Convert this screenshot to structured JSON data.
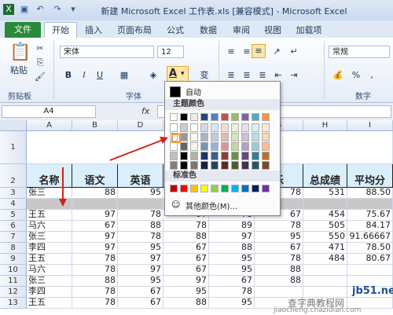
{
  "window": {
    "title": "新建 Microsoft Excel 工作表.xls [兼容模式] - Microsoft Excel"
  },
  "tabs": [
    {
      "label": "文件"
    },
    {
      "label": "开始"
    },
    {
      "label": "插入"
    },
    {
      "label": "页面布局"
    },
    {
      "label": "公式"
    },
    {
      "label": "数据"
    },
    {
      "label": "审阅"
    },
    {
      "label": "视图"
    },
    {
      "label": "加载项"
    }
  ],
  "ribbon": {
    "clipboard": {
      "paste_label": "粘贴",
      "group_label": "剪贴板"
    },
    "font": {
      "name": "宋体",
      "size": "12",
      "bold": "B",
      "italic": "I",
      "underline": "U",
      "color_btn": "A",
      "group_label": "字体"
    },
    "number": {
      "format": "常规",
      "percent": "%",
      "group_label": "数字"
    }
  },
  "formula_bar": {
    "name_box": "A4",
    "fx": "fx"
  },
  "columns": [
    "A",
    "B",
    "D",
    "E",
    "F",
    "G",
    "H",
    "I"
  ],
  "rows": [
    "1",
    "2",
    "3",
    "4",
    "5",
    "6",
    "7",
    "8",
    "9",
    "10",
    "11",
    "12",
    "13"
  ],
  "header_row": [
    "名称",
    "语文",
    "英语",
    "",
    "",
    "乐",
    "总成绩",
    "平均分"
  ],
  "data_rows": [
    [
      "张三",
      "88",
      "95",
      "",
      "",
      "78",
      "531",
      "88.50"
    ],
    [
      "",
      "",
      "",
      "",
      "",
      "",
      "",
      ""
    ],
    [
      "王五",
      "97",
      "78",
      "67",
      "78",
      "67",
      "454",
      "75.67"
    ],
    [
      "马六",
      "67",
      "88",
      "78",
      "89",
      "78",
      "505",
      "84.17"
    ],
    [
      "张三",
      "97",
      "78",
      "88",
      "97",
      "95",
      "550",
      "91.66667"
    ],
    [
      "李四",
      "97",
      "95",
      "67",
      "88",
      "67",
      "471",
      "78.50"
    ],
    [
      "王五",
      "78",
      "97",
      "67",
      "95",
      "78",
      "484",
      "80.67"
    ],
    [
      "马六",
      "78",
      "97",
      "67",
      "95",
      "88",
      "",
      ""
    ],
    [
      "张三",
      "88",
      "95",
      "97",
      "67",
      "88",
      "",
      ""
    ],
    [
      "李四",
      "78",
      "67",
      "95",
      "78",
      "",
      "",
      ""
    ],
    [
      "王五",
      "78",
      "67",
      "88",
      "95",
      "",
      "",
      ""
    ]
  ],
  "color_menu": {
    "auto_label": "自动",
    "theme_title": "主题颜色",
    "standard_title": "标准色",
    "more_label": "其他颜色(M)...",
    "theme_top": [
      "#ffffff",
      "#000000",
      "#eeece1",
      "#1f497d",
      "#4f81bd",
      "#c0504d",
      "#9bbb59",
      "#8064a2",
      "#4bacc6",
      "#f79646"
    ],
    "standard": [
      "#c00000",
      "#ff0000",
      "#ffc000",
      "#ffff00",
      "#92d050",
      "#00b050",
      "#00b0f0",
      "#0070c0",
      "#002060",
      "#7030a0"
    ]
  },
  "watermark": {
    "text1": "jb51.net",
    "text2": "查字典教程网",
    "text3": "jiaocheng.chazidian.com"
  }
}
